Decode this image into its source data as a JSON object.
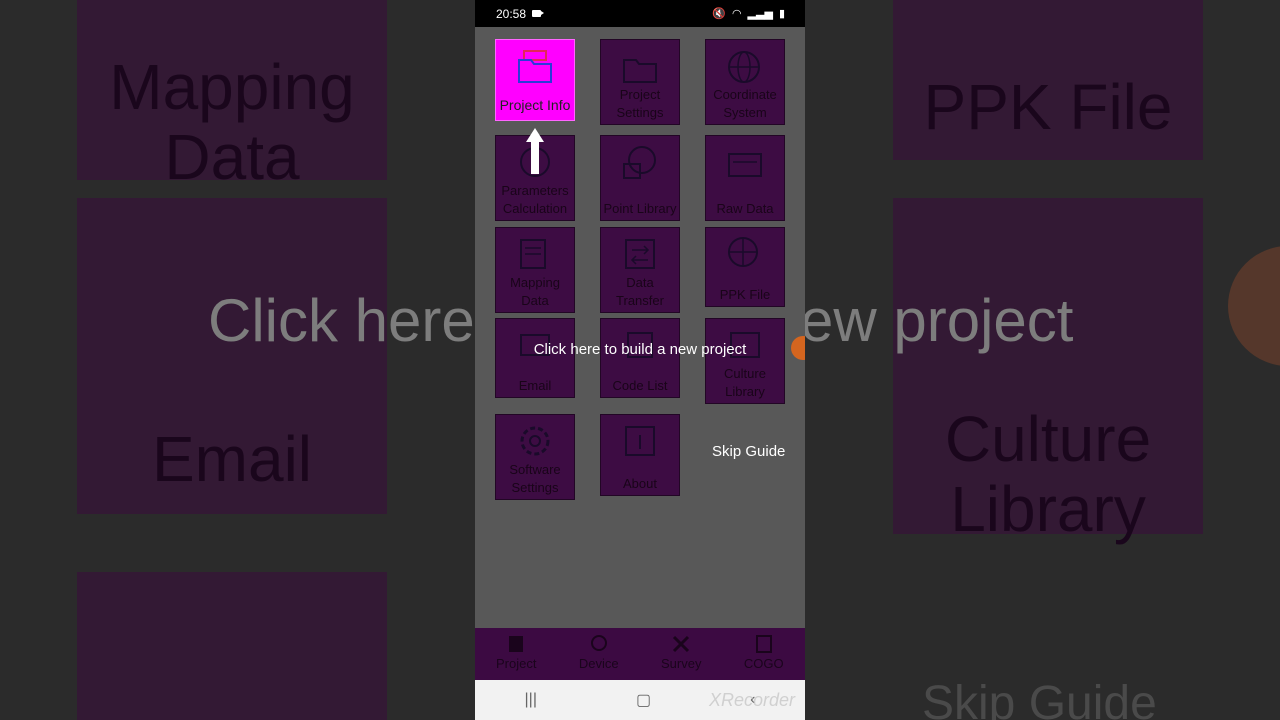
{
  "status": {
    "time": "20:58"
  },
  "tiles": [
    {
      "label": "Project Info"
    },
    {
      "label": "Project Settings"
    },
    {
      "label": "Coordinate System"
    },
    {
      "label": "Parameters Calculation"
    },
    {
      "label": "Point Library"
    },
    {
      "label": "Raw Data"
    },
    {
      "label": "Mapping Data"
    },
    {
      "label": "Data Transfer"
    },
    {
      "label": "PPK File"
    },
    {
      "label": "Email"
    },
    {
      "label": "Code List"
    },
    {
      "label": "Culture Library"
    },
    {
      "label": "Software Settings"
    },
    {
      "label": "About"
    }
  ],
  "guide": {
    "text": "Click here to build a new project",
    "skip": "Skip Guide"
  },
  "bottom_nav": [
    {
      "label": "Project"
    },
    {
      "label": "Device"
    },
    {
      "label": "Survey"
    },
    {
      "label": "COGO"
    }
  ],
  "watermark": "XRecorder",
  "background": {
    "left_top": "Mapping Data",
    "right_top": "PPK File",
    "left_mid": "Email",
    "right_mid": "Culture Library",
    "big_left": "Click here",
    "big_right": "ew project",
    "skip": "Skip Guide"
  },
  "colors": {
    "accent": "#ff00ff",
    "tile": "#3d0c43",
    "overlay": "#585858"
  }
}
